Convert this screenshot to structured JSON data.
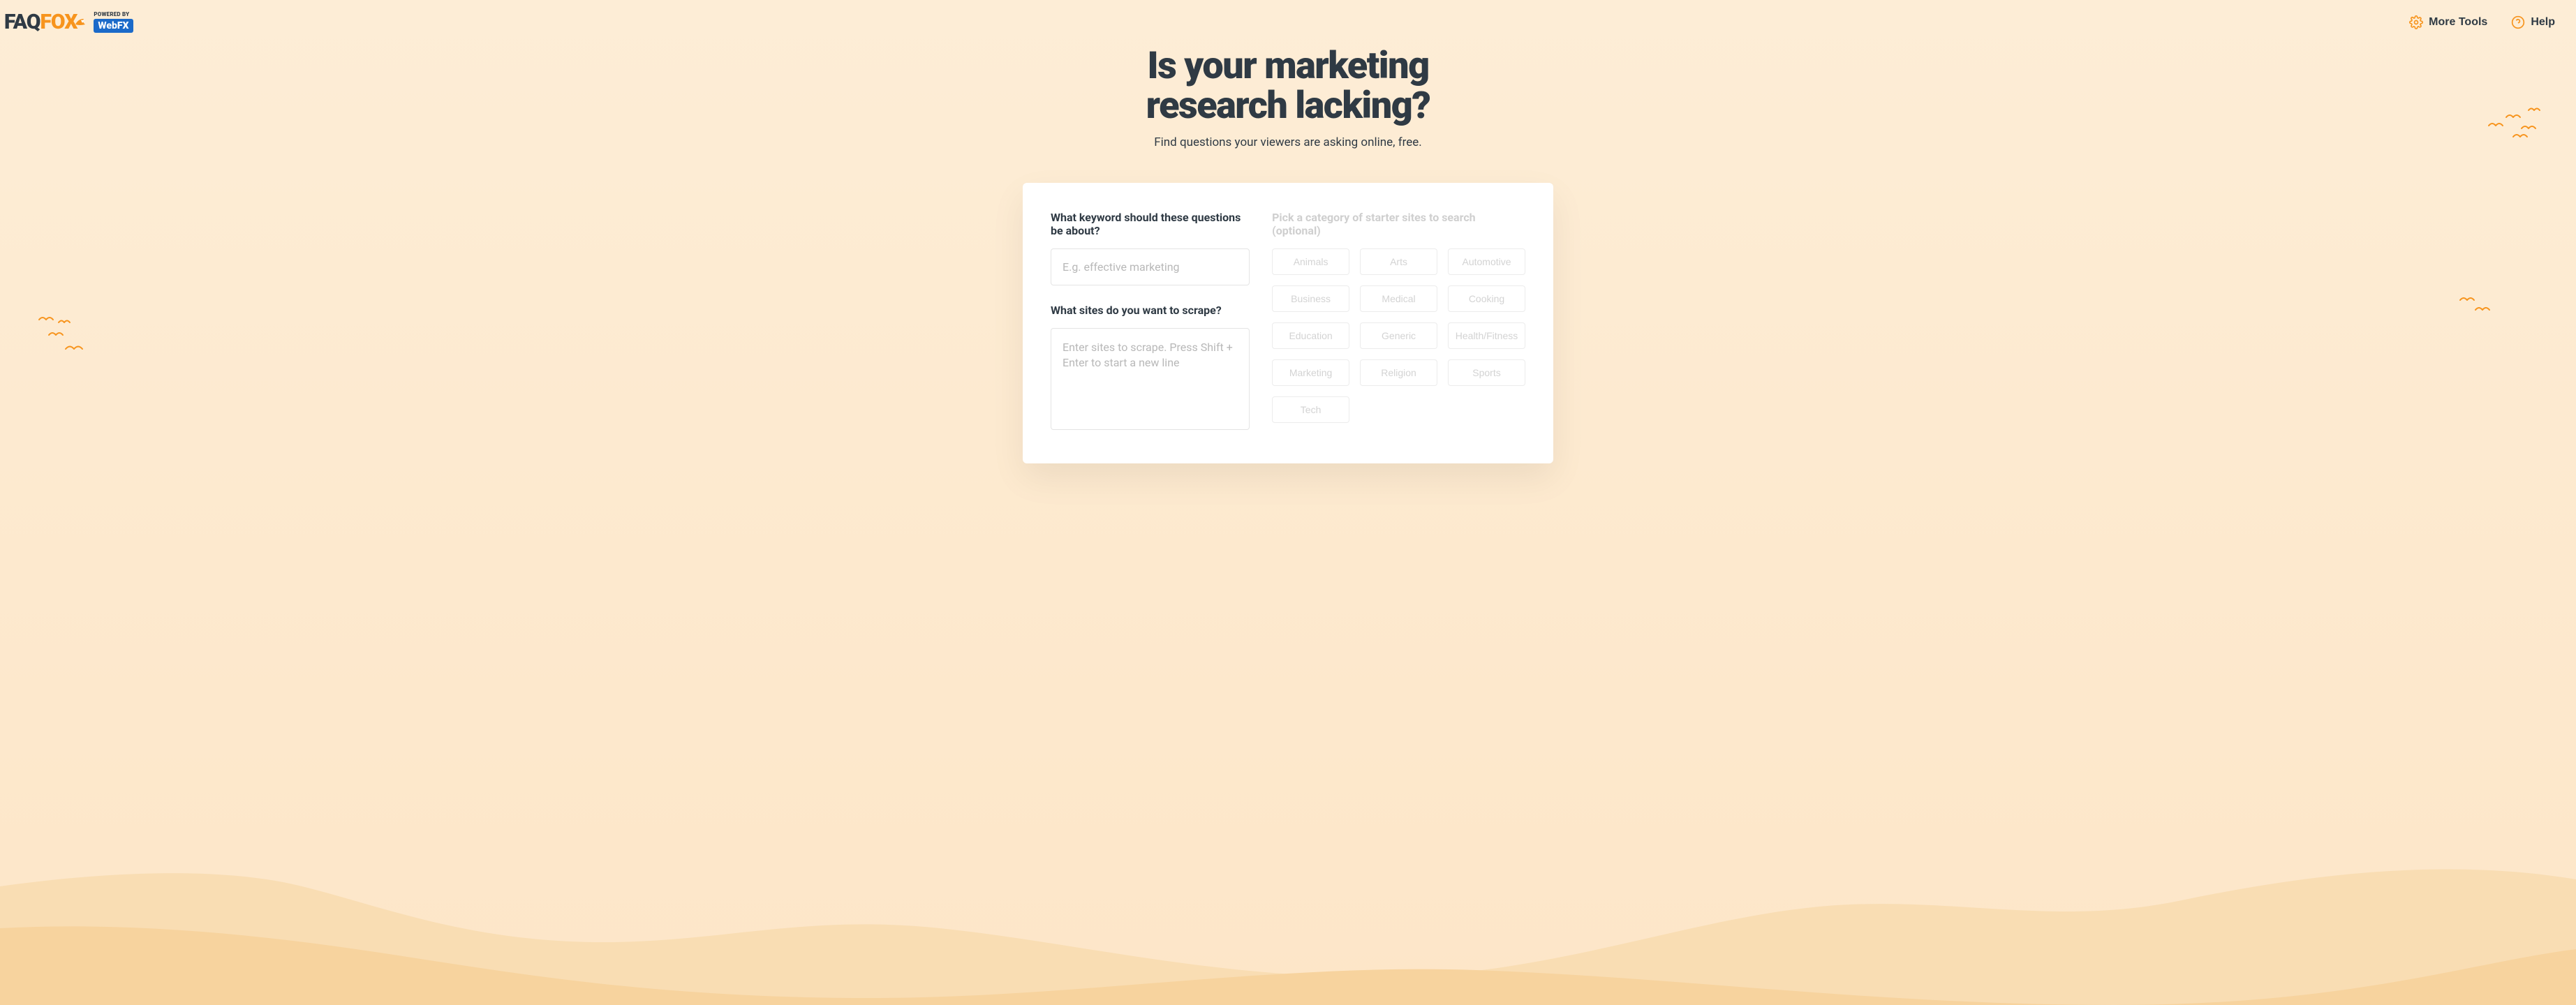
{
  "header": {
    "logo": {
      "faq": "FAQ",
      "fox": "FOX",
      "powered_by": "POWERED BY",
      "webfx_web": "Web",
      "webfx_fx": "FX"
    },
    "more_tools_label": "More Tools",
    "help_label": "Help"
  },
  "hero": {
    "title_line1": "Is your marketing",
    "title_line2": "research lacking?",
    "subtitle": "Find questions your viewers are asking online, free."
  },
  "form": {
    "keyword_label": "What keyword should these questions be about?",
    "keyword_placeholder": "E.g. effective marketing",
    "sites_label": "What sites do you want to scrape?",
    "sites_placeholder": "Enter sites to scrape. Press Shift + Enter to start a new line",
    "category_label": "Pick a category of starter sites to search (optional)",
    "categories": [
      "Animals",
      "Arts",
      "Automotive",
      "Business",
      "Medical",
      "Cooking",
      "Education",
      "Generic",
      "Health/Fitness",
      "Marketing",
      "Religion",
      "Sports",
      "Tech"
    ]
  }
}
